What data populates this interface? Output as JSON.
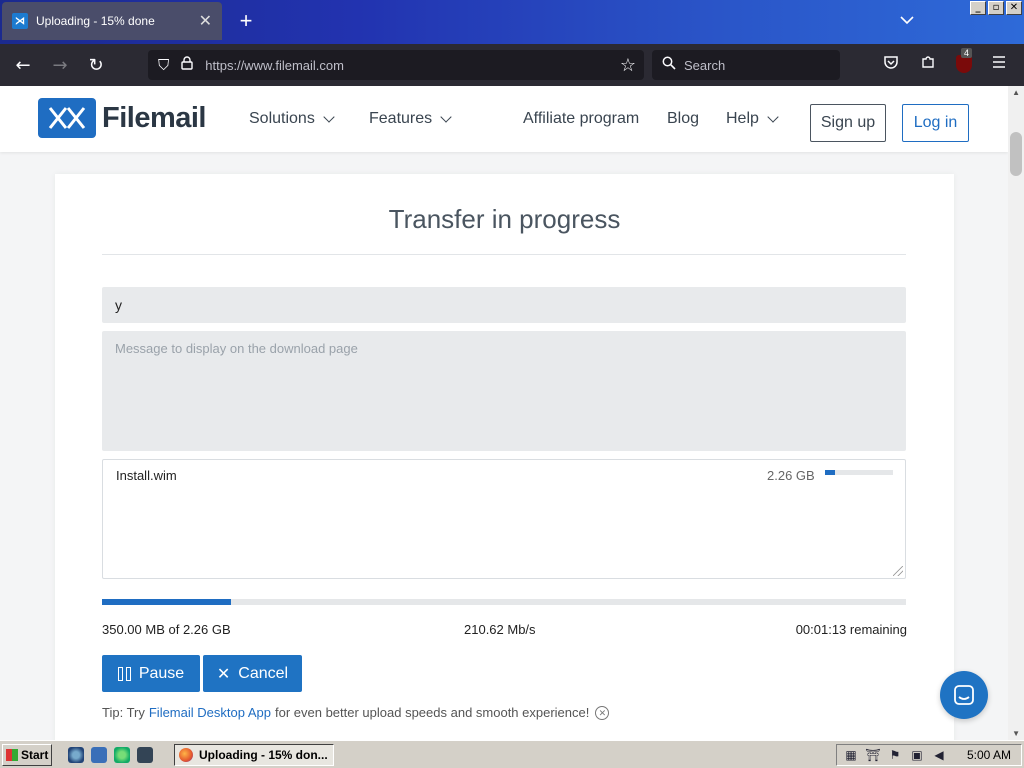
{
  "browser": {
    "tab_title": "Uploading - 15% done",
    "tab_icon_glyph": "⋊",
    "new_tab_glyph": "+",
    "close_tab_glyph": "✕",
    "url": "https://www.filemail.com",
    "search_placeholder": "Search",
    "extension_badge": "4"
  },
  "site": {
    "logo_text": "Filemail",
    "nav": {
      "solutions": "Solutions",
      "features": "Features",
      "affiliate": "Affiliate program",
      "blog": "Blog",
      "help": "Help"
    },
    "signup_label": "Sign up",
    "login_label": "Log in"
  },
  "transfer": {
    "title": "Transfer in progress",
    "to_value": "y",
    "message_placeholder": "Message to display on the download page",
    "file": {
      "name": "Install.wim",
      "size": "2.26 GB",
      "progress_fraction": 0.15
    },
    "overall_progress_fraction": 0.16,
    "transferred": "350.00 MB of 2.26 GB",
    "speed": "210.62 Mb/s",
    "remaining": "00:01:13 remaining",
    "pause_label": "Pause",
    "cancel_label": "Cancel",
    "tip_prefix": "Tip: Try",
    "tip_link": "Filemail Desktop App",
    "tip_suffix": "for even better upload speeds and smooth experience!"
  },
  "taskbar": {
    "start_label": "Start",
    "task_label": "Uploading - 15% don...",
    "clock": "5:00 AM"
  },
  "colors": {
    "brand_blue": "#1f6dc2",
    "button_blue": "#1f73c3",
    "browser_dark": "#2b2a33"
  }
}
